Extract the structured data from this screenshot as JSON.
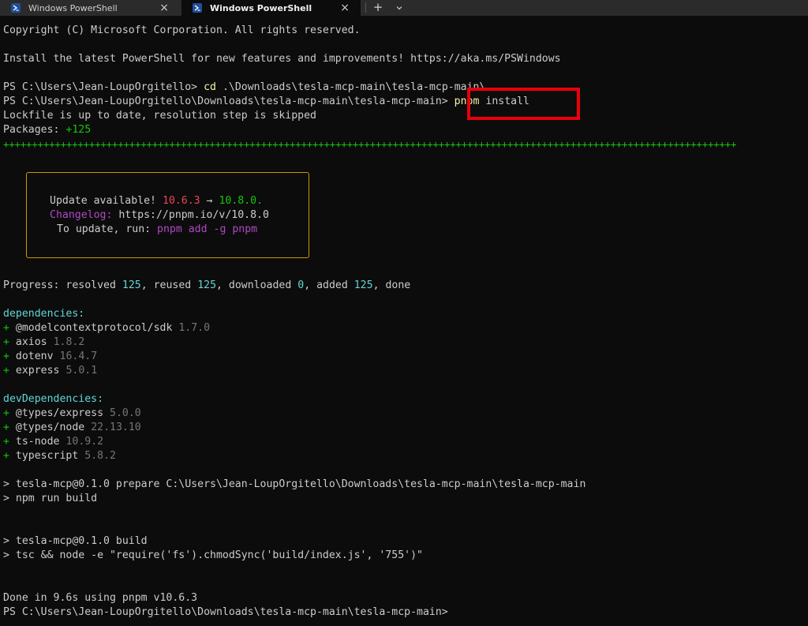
{
  "tabs": [
    {
      "title": "Windows PowerShell",
      "active": false
    },
    {
      "title": "Windows PowerShell",
      "active": true
    }
  ],
  "tabbar": {
    "new_tab": "+",
    "dropdown": "⌄"
  },
  "terminal": {
    "copyright": "Copyright (C) Microsoft Corporation. All rights reserved.",
    "install_hint": "Install the latest PowerShell for new features and improvements! https://aka.ms/PSWindows",
    "prompt1": "PS C:\\Users\\Jean-LoupOrgitello>",
    "cmd1_keyword": "cd",
    "cmd1_args": ".\\Downloads\\tesla-mcp-main\\tesla-mcp-main\\",
    "prompt2": "PS C:\\Users\\Jean-LoupOrgitello\\Downloads\\tesla-mcp-main\\tesla-mcp-main>",
    "cmd2_keyword": "pnpm",
    "cmd2_args": "install",
    "lockfile": "Lockfile is up to date, resolution step is skipped",
    "packages_label": "Packages:",
    "packages_value": "+125",
    "plusbar": "++++++++++++++++++++++++++++++++++++++++++++++++++++++++++++++++++++++++++++++++++++++++++++++++++++++++++++++++++++++++++++++++",
    "update": {
      "line1_prefix": "Update available!",
      "from_version": "10.6.3",
      "arrow": "→",
      "to_version": "10.8.0.",
      "changelog_label": "Changelog:",
      "changelog_url": "https://pnpm.io/v/10.8.0",
      "to_update": "To update, run:",
      "update_cmd": "pnpm add -g pnpm"
    },
    "progress": {
      "prefix": "Progress: resolved",
      "resolved": "125",
      "reused_label": ", reused",
      "reused": "125",
      "downloaded_label": ", downloaded",
      "downloaded": "0",
      "added_label": ", added",
      "added": "125",
      "done": ", done"
    },
    "dependencies_header": "dependencies:",
    "dependencies": [
      {
        "name": "@modelcontextprotocol/sdk",
        "version": "1.7.0"
      },
      {
        "name": "axios",
        "version": "1.8.2"
      },
      {
        "name": "dotenv",
        "version": "16.4.7"
      },
      {
        "name": "express",
        "version": "5.0.1"
      }
    ],
    "dev_dependencies_header": "devDependencies:",
    "dev_dependencies": [
      {
        "name": "@types/express",
        "version": "5.0.0"
      },
      {
        "name": "@types/node",
        "version": "22.13.10"
      },
      {
        "name": "ts-node",
        "version": "10.9.2"
      },
      {
        "name": "typescript",
        "version": "5.8.2"
      }
    ],
    "plus": "+",
    "prepare_line": "> tesla-mcp@0.1.0 prepare C:\\Users\\Jean-LoupOrgitello\\Downloads\\tesla-mcp-main\\tesla-mcp-main",
    "npm_run_build": "> npm run build",
    "build_line": "> tesla-mcp@0.1.0 build",
    "tsc_line": "> tsc && node -e \"require('fs').chmodSync('build/index.js', '755')\"",
    "done_line": "Done in 9.6s using pnpm v10.6.3",
    "final_prompt": "PS C:\\Users\\Jean-LoupOrgitello\\Downloads\\tesla-mcp-main\\tesla-mcp-main>"
  },
  "colors": {
    "background": "#0c0c0c",
    "highlight_border": "#e8000b",
    "update_border": "#c19c00"
  }
}
